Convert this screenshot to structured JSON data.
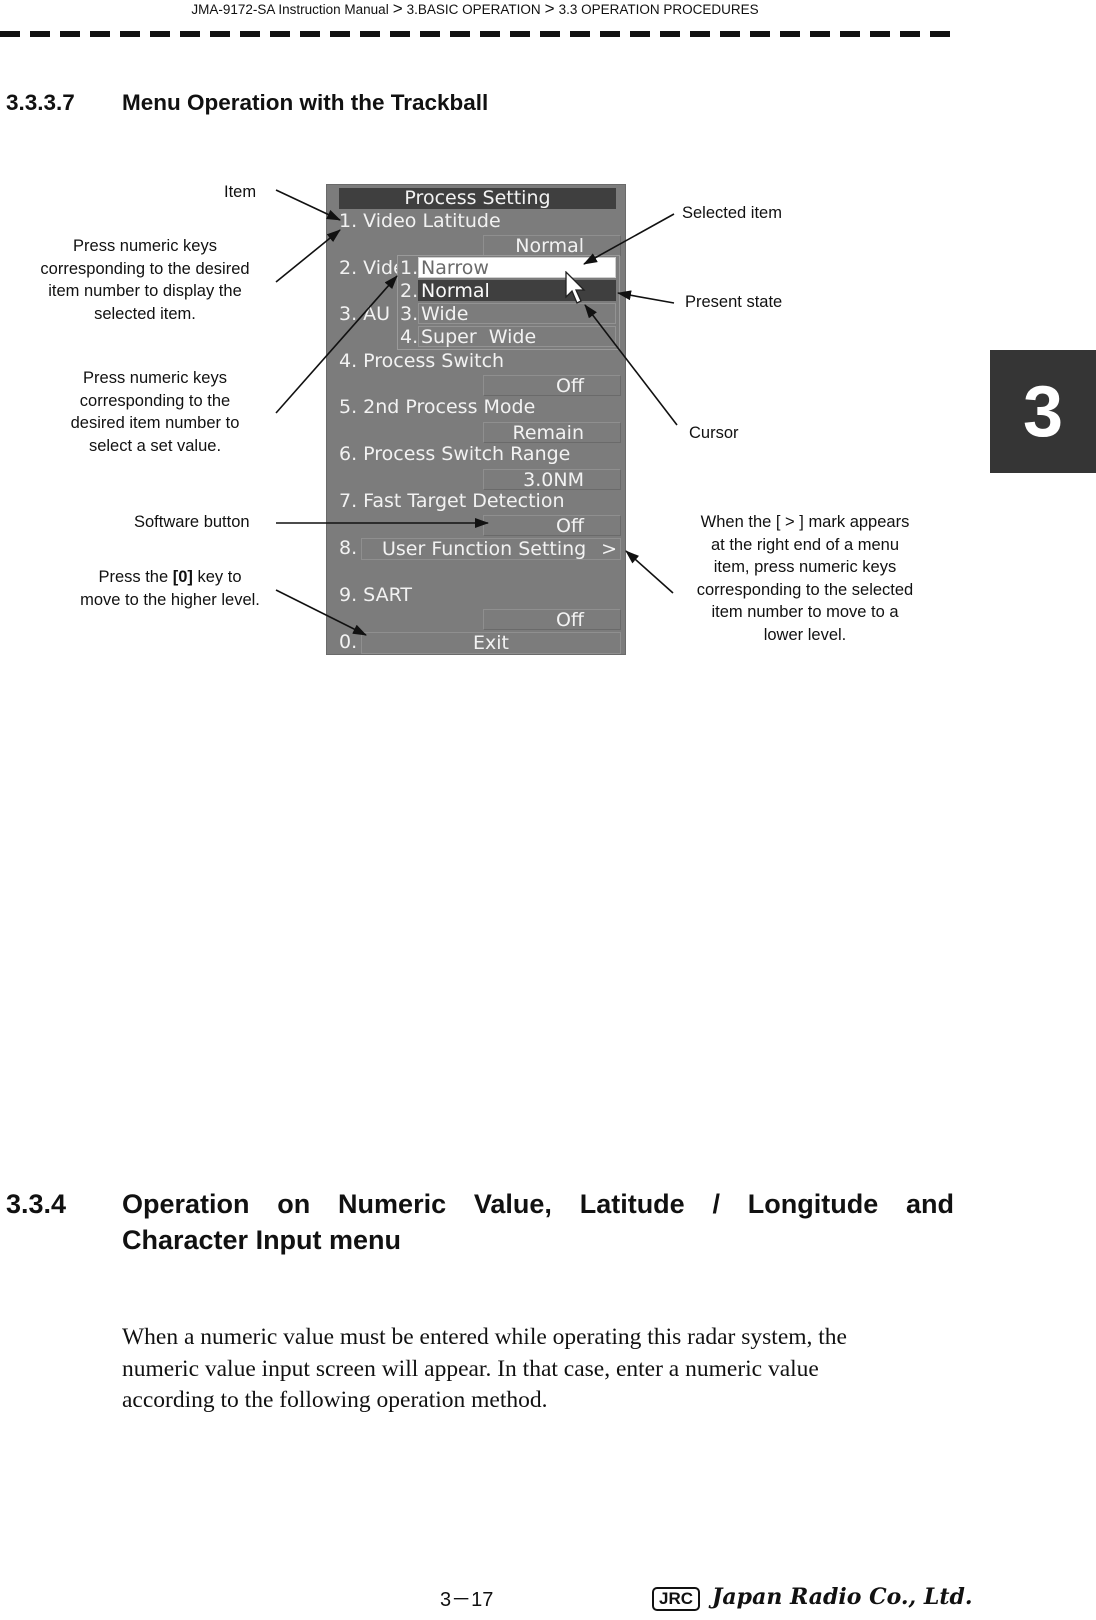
{
  "header": {
    "breadcrumb": [
      "JMA-9172-SA Instruction Manual",
      "3.BASIC OPERATION",
      "3.3  OPERATION PROCEDURES"
    ],
    "separator": ">"
  },
  "chapter_tab": "3",
  "section1": {
    "number": "3.3.3.7",
    "title": "Menu Operation with the Trackball"
  },
  "figure": {
    "menu": {
      "title": "Process Setting",
      "items": [
        {
          "label": "1. Video Latitude",
          "value": "Normal"
        },
        {
          "label": "2. Vide",
          "value": ""
        },
        {
          "label": "3. AU",
          "value": ""
        },
        {
          "label": "4. Process Switch",
          "value": "Off"
        },
        {
          "label": "5. 2nd Process Mode",
          "value": "Remain"
        },
        {
          "label": "6. Process Switch Range",
          "value": "3.0NM"
        },
        {
          "label": "7. Fast Target Detection",
          "value": "Off"
        },
        {
          "label": "8.",
          "button": "User Function Setting",
          "submenu_mark": ">"
        },
        {
          "label": "9. SART",
          "value": "Off"
        },
        {
          "label": "0.",
          "button": "Exit"
        }
      ],
      "dropdown": {
        "options": [
          {
            "num": "1.",
            "label": "Narrow",
            "state": "selected"
          },
          {
            "num": "2.",
            "label": "Normal",
            "state": "present"
          },
          {
            "num": "3.",
            "label": "Wide",
            "state": ""
          },
          {
            "num": "4.",
            "label": "Super  Wide",
            "state": ""
          }
        ]
      }
    },
    "annotations": {
      "item": "Item",
      "press_display": [
        "Press numeric keys",
        "corresponding to the desired",
        "item number to display the",
        "selected item."
      ],
      "press_select": [
        "Press numeric keys",
        "corresponding to the",
        "desired item number to",
        "select a set value."
      ],
      "software_button": "Software button",
      "press_zero_pre": "Press the ",
      "press_zero_key": "[0]",
      "press_zero_post": " key to",
      "press_zero_line2": "move to the higher level.",
      "selected_item": "Selected item",
      "present_state": "Present state",
      "cursor": "Cursor",
      "lower_level": [
        "When the [ > ] mark appears",
        "at the right end of a menu",
        "item, press numeric keys",
        "corresponding to the selected",
        "item number to move to a",
        "lower level."
      ]
    }
  },
  "section2": {
    "number": "3.3.4",
    "title_line1": "Operation on Numeric Value, Latitude / Longitude and",
    "title_line2": "Character Input menu",
    "paragraph_lines": [
      "When a numeric value must be entered while operating this radar system, the",
      "numeric value input screen will appear. In that case, enter a numeric value",
      "according to the following operation method."
    ]
  },
  "footer": {
    "page": "3－17",
    "logo_mark": "JRC",
    "company": "Japan Radio Co., Ltd."
  }
}
